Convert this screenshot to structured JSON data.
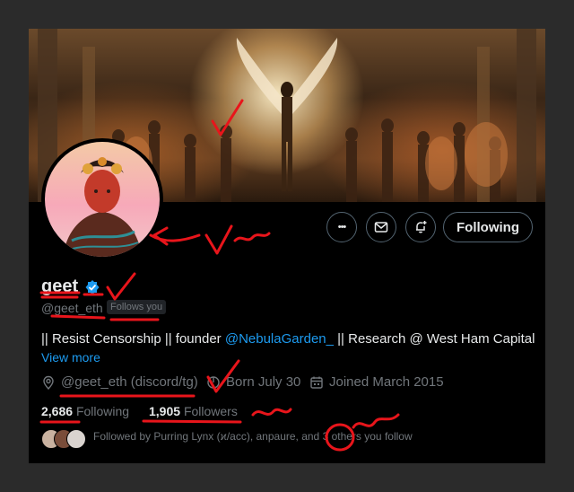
{
  "profile": {
    "display_name": "geet",
    "handle": "@geet_eth",
    "follows_you_label": "Follows you",
    "bio_prefix": "|| Resist Censorship || founder ",
    "bio_mention": "@NebulaGarden_",
    "bio_suffix": " || Research @ West Ham Capital",
    "view_more": "View more",
    "location": "@geet_eth (discord/tg)",
    "birthday": "Born July 30",
    "joined": "Joined March 2015"
  },
  "actions": {
    "more_label": "•••",
    "following_label": "Following"
  },
  "stats": {
    "following_count": "2,686",
    "following_label": "Following",
    "followers_count": "1,905",
    "followers_label": "Followers"
  },
  "followed_by_text": "Followed by Purring Lynx (ϰ/acc), anpaure, and 3 others you follow",
  "colors": {
    "background": "#000000",
    "accent": "#1d9bf0",
    "text_primary": "#e7e9ea",
    "text_secondary": "#71767b",
    "annotation": "#e8151b"
  },
  "icons": [
    "verified-badge-icon",
    "mail-icon",
    "bell-plus-icon",
    "location-icon",
    "birthday-icon",
    "calendar-icon"
  ]
}
